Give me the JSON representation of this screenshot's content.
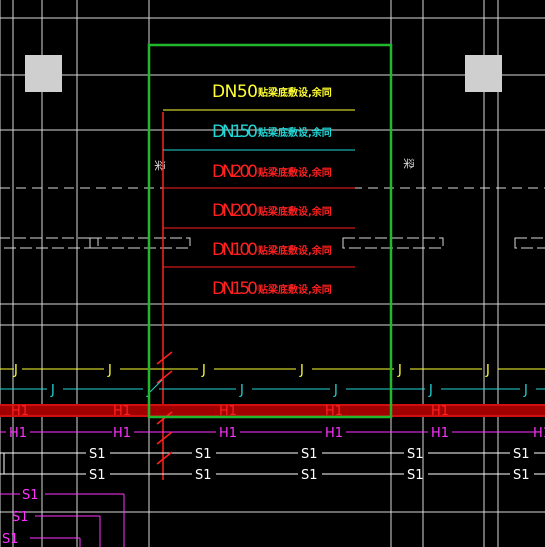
{
  "drawing": {
    "colors": {
      "background": "#000000",
      "grid": "#d9d9d9",
      "selection": "#22b82e",
      "yellow": "#ffff33",
      "cyan": "#22d6d6",
      "red": "#ff2020",
      "dark_red": "#a00000",
      "magenta": "#ff33ff",
      "white": "#ffffff",
      "column": "#cfcfcf"
    },
    "pipe_labels": [
      {
        "size": "DN50",
        "note": "贴梁底敷设,余同",
        "color": "yellow"
      },
      {
        "size": "DN150",
        "note": "贴梁底敷设,余同",
        "color": "cyan"
      },
      {
        "size": "DN200",
        "note": "贴梁底敷设,余同",
        "color": "red"
      },
      {
        "size": "DN200",
        "note": "贴梁底敷设,余同",
        "color": "red"
      },
      {
        "size": "DN100",
        "note": "贴梁底敷设,余同",
        "color": "red"
      },
      {
        "size": "DN150",
        "note": "贴梁底敷设,余同",
        "color": "red"
      }
    ],
    "side_text_left": "梁",
    "side_text_right": "梁",
    "pipe_rows": [
      {
        "code": "J",
        "color": "yellow"
      },
      {
        "code": "J",
        "color": "cyan"
      },
      {
        "code": "H1",
        "color": "red"
      },
      {
        "code": "H1",
        "color": "magenta"
      },
      {
        "code": "S1",
        "color": "white"
      },
      {
        "code": "S1",
        "color": "white"
      }
    ],
    "left_branch_codes": [
      "S1",
      "S1",
      "S1"
    ]
  }
}
